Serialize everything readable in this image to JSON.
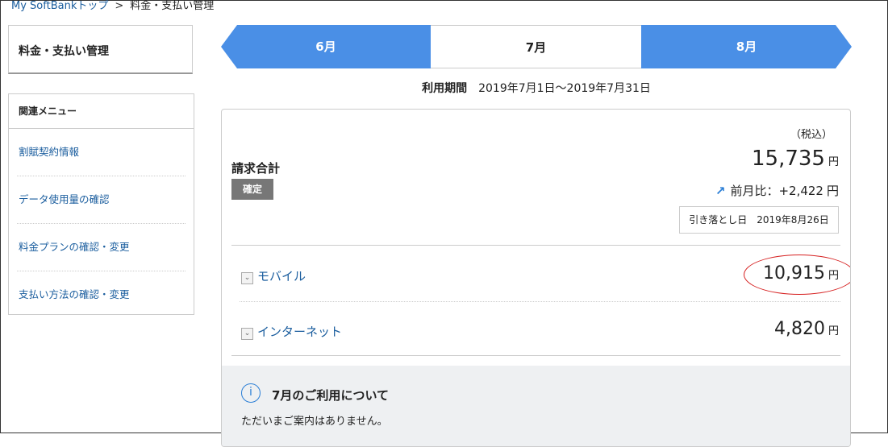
{
  "breadcrumb": {
    "home": "My SoftBankトップ",
    "separator": ">",
    "current": "料金・支払い管理"
  },
  "sidebar": {
    "title": "料金・支払い管理",
    "menu_header": "関連メニュー",
    "items": [
      {
        "label": "割賦契約情報"
      },
      {
        "label": "データ使用量の確認"
      },
      {
        "label": "料金プランの確認・変更"
      },
      {
        "label": "支払い方法の確認・変更"
      }
    ]
  },
  "tabs": {
    "prev": "6月",
    "current": "7月",
    "next": "8月"
  },
  "period": {
    "label": "利用期間",
    "value": "2019年7月1日～2019年7月31日"
  },
  "bill": {
    "tax_note": "（税込）",
    "total_label": "請求合計",
    "status_badge": "確定",
    "total_amount": "15,735",
    "yen": "円",
    "diff_label": "前月比：+2,422",
    "due_label": "引き落とし日　2019年8月26日",
    "rows": [
      {
        "label": "モバイル",
        "amount": "10,915"
      },
      {
        "label": "インターネット",
        "amount": "4,820"
      }
    ]
  },
  "notice": {
    "title": "7月のご利用について",
    "text": "ただいまご案内はありません。"
  },
  "icons": {
    "diff": "arrow-up-right-icon",
    "expand": "chevron-down-icon",
    "info": "info-icon"
  }
}
